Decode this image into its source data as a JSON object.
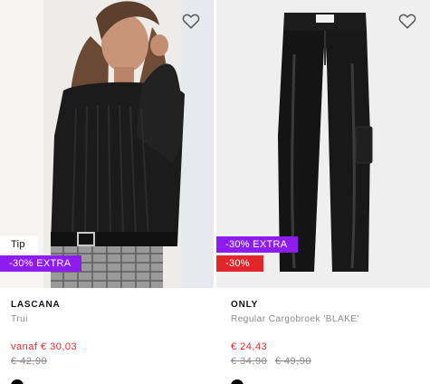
{
  "products": [
    {
      "brand": "LASCANA",
      "name": "Trui",
      "price": "vanaf € 30,03",
      "old_prices": [
        "€ 42,90"
      ],
      "badges": {
        "tip": "Tip",
        "extra": "-30% EXTRA"
      },
      "swatch_color": "#000000",
      "icons": {
        "wishlist": "heart-outline-icon"
      }
    },
    {
      "brand": "ONLY",
      "name": "Regular Cargobroek 'BLAKE'",
      "price": "€ 24,43",
      "old_prices": [
        "€ 34,90",
        "€ 49,90"
      ],
      "badges": {
        "extra": "-30% EXTRA",
        "discount": "-30%"
      },
      "swatch_color": "#000000",
      "icons": {
        "wishlist": "heart-outline-icon"
      }
    }
  ],
  "colors": {
    "sale_red": "#e3262a",
    "extra_purple": "#8c1cf0"
  }
}
